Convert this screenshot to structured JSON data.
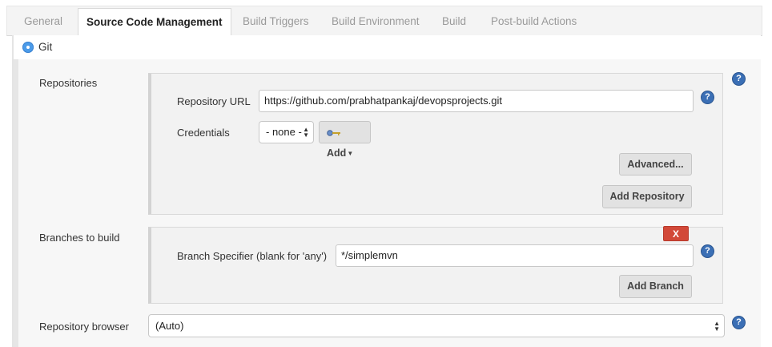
{
  "tabs": [
    {
      "label": "General"
    },
    {
      "label": "Source Code Management"
    },
    {
      "label": "Build Triggers"
    },
    {
      "label": "Build Environment"
    },
    {
      "label": "Build"
    },
    {
      "label": "Post-build Actions"
    }
  ],
  "scm": {
    "option_label": "Git",
    "option_selected": true
  },
  "repositories": {
    "label": "Repositories",
    "url_label": "Repository URL",
    "url_value": "https://github.com/prabhatpankaj/devopsprojects.git",
    "credentials_label": "Credentials",
    "credentials_value": "- none -",
    "add_label": "Add",
    "advanced_label": "Advanced...",
    "add_repository_label": "Add Repository"
  },
  "branches": {
    "label": "Branches to build",
    "delete_label": "X",
    "specifier_label": "Branch Specifier (blank for 'any')",
    "specifier_value": "*/simplemvn",
    "add_branch_label": "Add Branch"
  },
  "browser": {
    "label": "Repository browser",
    "value": "(Auto)"
  },
  "help": {
    "glyph": "?"
  },
  "colors": {
    "help_icon": "#3b6fb5",
    "radio": "#4b9be9",
    "delete_button": "#d24939"
  }
}
